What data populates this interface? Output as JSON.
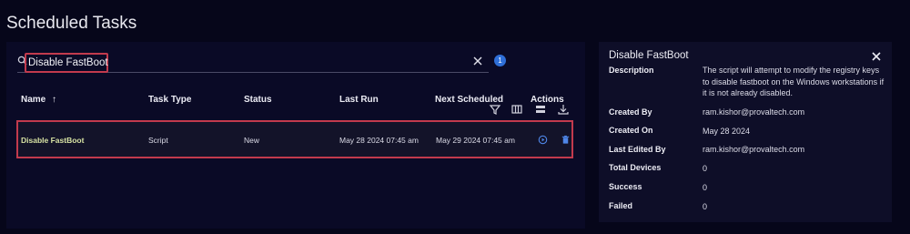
{
  "page": {
    "title": "Scheduled Tasks"
  },
  "search": {
    "value": "Disable FastBoot",
    "placeholder": ""
  },
  "toolbar": {
    "filter_count": "1"
  },
  "table": {
    "columns": {
      "name": "Name",
      "sort_indicator": "↑",
      "task_type": "Task Type",
      "status": "Status",
      "last_run": "Last Run",
      "next_scheduled": "Next Scheduled",
      "actions": "Actions"
    },
    "rows": [
      {
        "name": "Disable FastBoot",
        "task_type": "Script",
        "status": "New",
        "last_run": "May 28 2024 07:45 am",
        "next_scheduled": "May 29 2024 07:45 am"
      }
    ]
  },
  "details": {
    "title": "Disable FastBoot",
    "fields": {
      "description_label": "Description",
      "description_value": "The script will attempt to modify the registry keys to disable fastboot on the Windows workstations if it is not already disabled.",
      "created_by_label": "Created By",
      "created_by_value": "ram.kishor@provaltech.com",
      "created_on_label": "Created On",
      "created_on_value": "May 28 2024",
      "last_edited_by_label": "Last Edited By",
      "last_edited_by_value": "ram.kishor@provaltech.com",
      "total_devices_label": "Total Devices",
      "total_devices_value": "0",
      "success_label": "Success",
      "success_value": "0",
      "failed_label": "Failed",
      "failed_value": "0"
    }
  },
  "colors": {
    "background": "#06061a",
    "panel": "#0a0a26",
    "highlight_border": "#c23a4d",
    "badge": "#2f6fd8",
    "task_name": "#d8e3a4"
  },
  "icons": {
    "search": "search-icon",
    "clear": "close-icon",
    "filter": "filter-icon",
    "columns": "columns-icon",
    "density": "density-icon",
    "download": "download-icon",
    "run": "play-circle-icon",
    "delete": "trash-icon",
    "close_details": "close-icon"
  }
}
